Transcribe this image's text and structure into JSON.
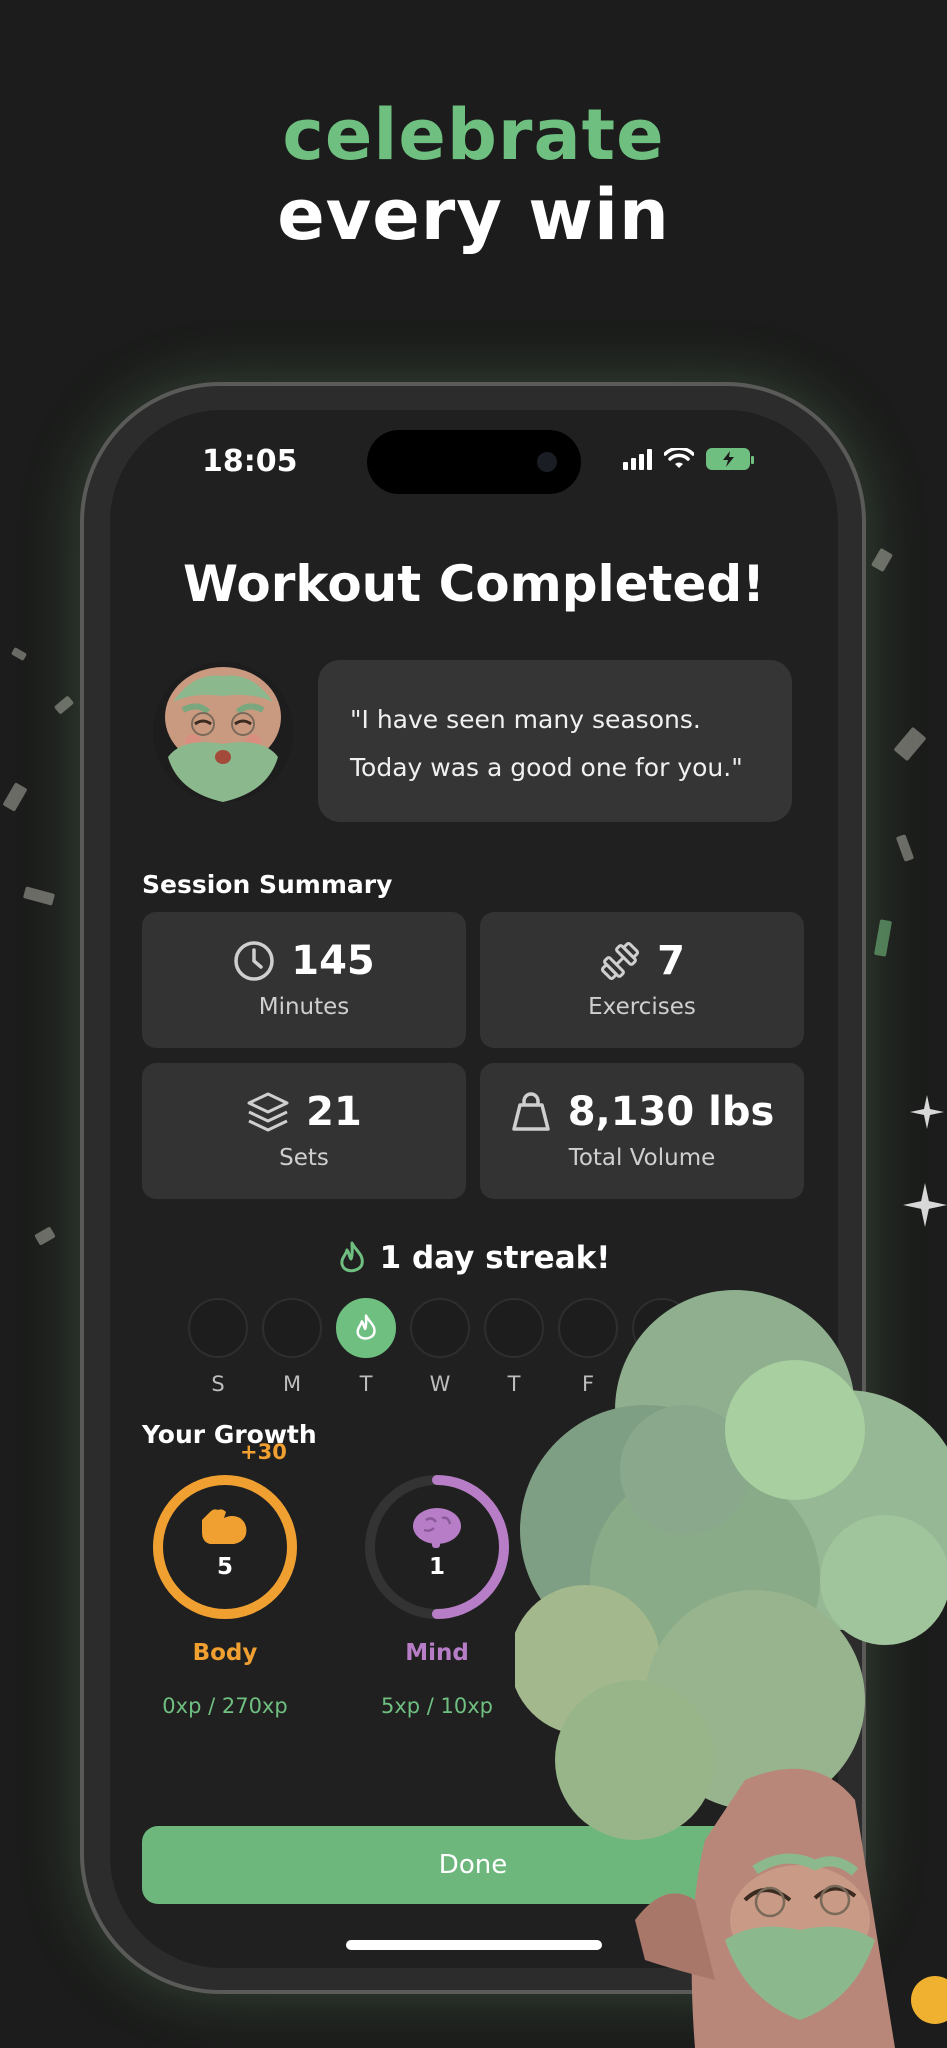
{
  "hero": {
    "line1": "celebrate",
    "line2": "every win"
  },
  "status_bar": {
    "time": "18:05"
  },
  "screen": {
    "title": "Workout Completed!",
    "quote": {
      "line1": "\"I have seen many seasons.",
      "line2": "Today was a good one for you.\""
    },
    "session_summary": {
      "heading": "Session Summary",
      "stats": [
        {
          "icon": "clock-icon",
          "value": "145",
          "label": "Minutes"
        },
        {
          "icon": "dumbbell-icon",
          "value": "7",
          "label": "Exercises"
        },
        {
          "icon": "layers-icon",
          "value": "21",
          "label": "Sets"
        },
        {
          "icon": "kettlebell-icon",
          "value": "8,130 lbs",
          "label": "Total Volume"
        }
      ]
    },
    "streak": {
      "label": "1 day streak!",
      "days": [
        {
          "letter": "S",
          "active": false
        },
        {
          "letter": "M",
          "active": false
        },
        {
          "letter": "T",
          "active": true
        },
        {
          "letter": "W",
          "active": false
        },
        {
          "letter": "T",
          "active": false
        },
        {
          "letter": "F",
          "active": false
        },
        {
          "letter": "S",
          "active": false
        }
      ]
    },
    "growth": {
      "heading": "Your Growth",
      "gain": "+30",
      "items": [
        {
          "name": "Body",
          "level": "5",
          "xp": "0xp / 270xp",
          "progress": 1.0,
          "color": "#f0a030",
          "icon": "flexed-arm-icon"
        },
        {
          "name": "Mind",
          "level": "1",
          "xp": "5xp / 10xp",
          "progress": 0.5,
          "color": "#b77ec7",
          "icon": "brain-icon"
        }
      ]
    },
    "done_button": "Done"
  },
  "colors": {
    "accent": "#6fbf80",
    "background": "#1b1c1b",
    "card": "#333333"
  }
}
